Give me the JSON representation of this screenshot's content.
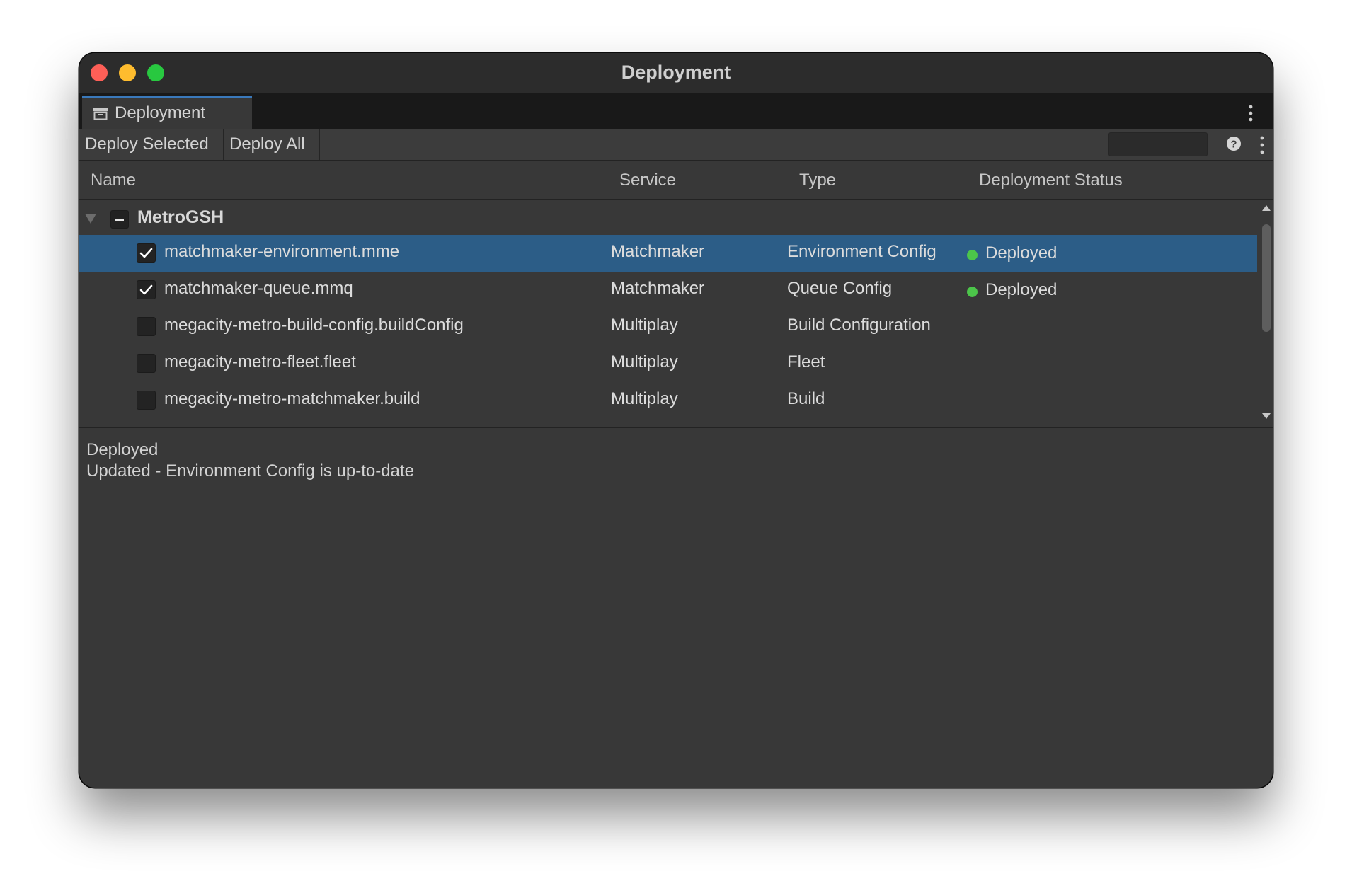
{
  "window": {
    "title": "Deployment"
  },
  "tab": {
    "label": "Deployment"
  },
  "toolbar": {
    "deploy_selected_label": "Deploy Selected",
    "deploy_all_label": "Deploy All",
    "search_value": ""
  },
  "columns": {
    "name": "Name",
    "service": "Service",
    "type": "Type",
    "status": "Deployment Status"
  },
  "group": {
    "label": "MetroGSH",
    "expanded": true,
    "check_state": "mixed"
  },
  "items": [
    {
      "name": "matchmaker-environment.mme",
      "service": "Matchmaker",
      "type": "Environment Config",
      "status": "Deployed",
      "checked": true,
      "selected": true
    },
    {
      "name": "matchmaker-queue.mmq",
      "service": "Matchmaker",
      "type": "Queue Config",
      "status": "Deployed",
      "checked": true,
      "selected": false
    },
    {
      "name": "megacity-metro-build-config.buildConfig",
      "service": "Multiplay",
      "type": "Build Configuration",
      "status": "",
      "checked": false,
      "selected": false
    },
    {
      "name": "megacity-metro-fleet.fleet",
      "service": "Multiplay",
      "type": "Fleet",
      "status": "",
      "checked": false,
      "selected": false
    },
    {
      "name": "megacity-metro-matchmaker.build",
      "service": "Multiplay",
      "type": "Build",
      "status": "",
      "checked": false,
      "selected": false
    }
  ],
  "details": {
    "status_line": "Deployed",
    "message_line": "Updated - Environment Config is up-to-date"
  },
  "colors": {
    "selection": "#2c5d87",
    "status_deployed": "#4cc54a",
    "tab_accent": "#3a79bb"
  },
  "icons": {
    "tab": "deployment-window-icon",
    "help": "help-icon",
    "menu": "kebab-menu-icon",
    "fold": "disclosure-triangle-icon"
  }
}
